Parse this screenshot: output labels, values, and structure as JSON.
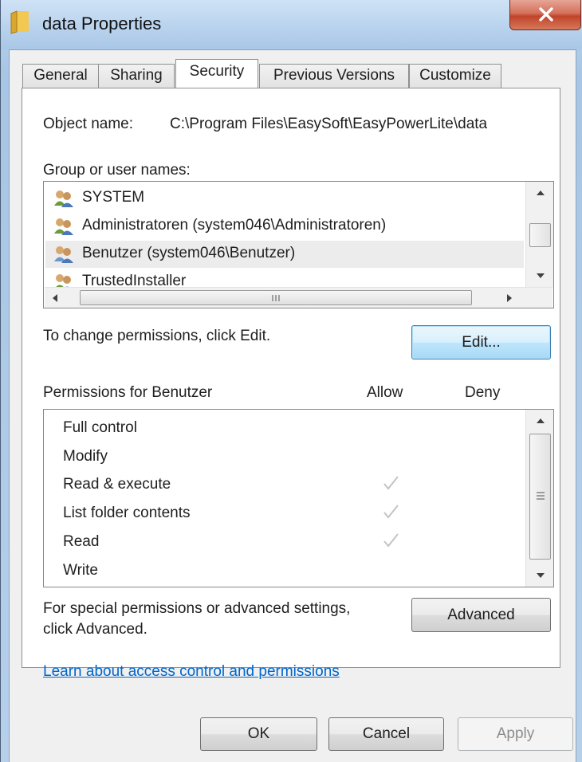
{
  "window": {
    "title": "data Properties",
    "close_label": "x"
  },
  "tabs": [
    {
      "label": "General"
    },
    {
      "label": "Sharing"
    },
    {
      "label": "Security"
    },
    {
      "label": "Previous Versions"
    },
    {
      "label": "Customize"
    }
  ],
  "security": {
    "object_name_label": "Object name:",
    "object_name_value": "C:\\Program Files\\EasySoft\\EasyPowerLite\\data",
    "group_label": "Group or user names:",
    "users": [
      {
        "name": "SYSTEM",
        "icon": "users-icon"
      },
      {
        "name": "Administratoren (system046\\Administratoren)",
        "icon": "users-icon"
      },
      {
        "name": "Benutzer (system046\\Benutzer)",
        "icon": "users-icon",
        "selected": true
      },
      {
        "name": "TrustedInstaller",
        "icon": "users-icon"
      }
    ],
    "change_hint": "To change permissions, click Edit.",
    "edit_button": "Edit...",
    "permissions_for": "Permissions for Benutzer",
    "allow_header": "Allow",
    "deny_header": "Deny",
    "permissions": [
      {
        "name": "Full control",
        "allow": false,
        "deny": false
      },
      {
        "name": "Modify",
        "allow": false,
        "deny": false
      },
      {
        "name": "Read & execute",
        "allow": true,
        "deny": false
      },
      {
        "name": "List folder contents",
        "allow": true,
        "deny": false
      },
      {
        "name": "Read",
        "allow": true,
        "deny": false
      },
      {
        "name": "Write",
        "allow": false,
        "deny": false
      }
    ],
    "special_line1": "For special permissions or advanced settings,",
    "special_line2": "click Advanced.",
    "advanced_button": "Advanced",
    "learn_link": "Learn about access control and permissions"
  },
  "footer": {
    "ok": "OK",
    "cancel": "Cancel",
    "apply": "Apply"
  },
  "colors": {
    "link": "#0066cc",
    "checkmark": "#c4c4c4",
    "close_button": "#c7432a"
  }
}
